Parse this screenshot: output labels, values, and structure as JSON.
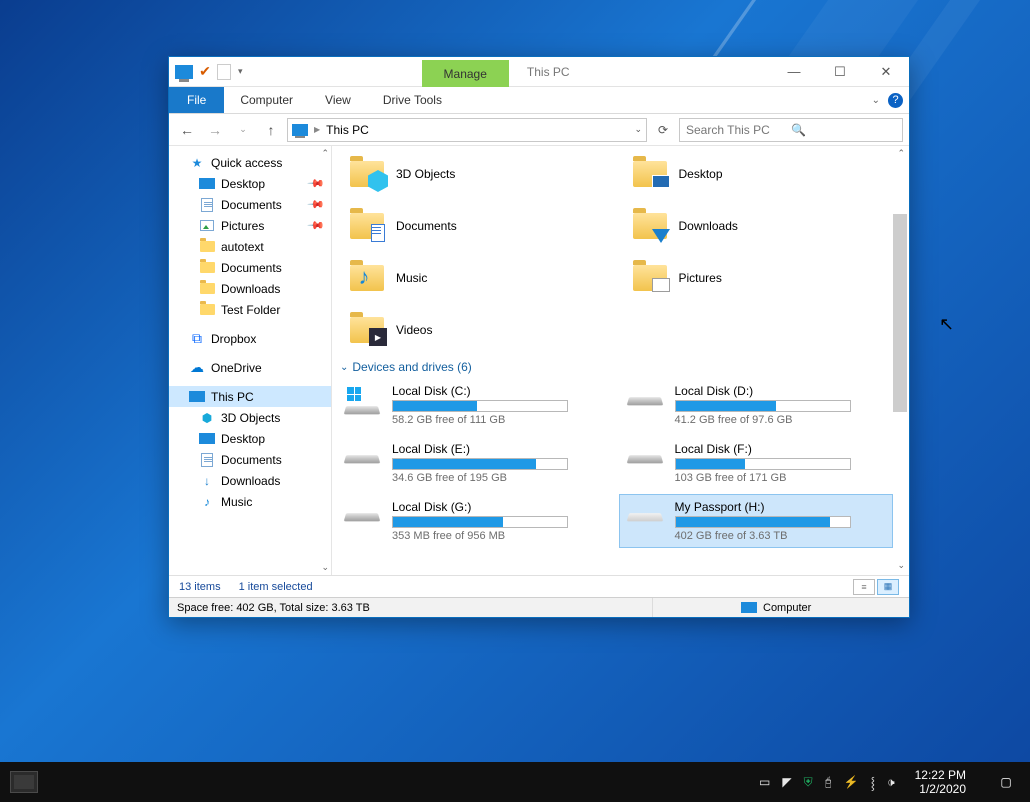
{
  "window": {
    "title": "This PC",
    "contextual_tab": "Manage",
    "ribbon_tabs": {
      "file": "File",
      "computer": "Computer",
      "view": "View",
      "drive_tools": "Drive Tools"
    }
  },
  "address": {
    "location": "This PC"
  },
  "search": {
    "placeholder": "Search This PC"
  },
  "sidebar": {
    "quick_access": "Quick access",
    "qa": {
      "desktop": "Desktop",
      "documents": "Documents",
      "pictures": "Pictures",
      "autotext": "autotext",
      "documents2": "Documents",
      "downloads": "Downloads",
      "test_folder": "Test Folder"
    },
    "dropbox": "Dropbox",
    "onedrive": "OneDrive",
    "this_pc": "This PC",
    "pc": {
      "objects3d": "3D Objects",
      "desktop": "Desktop",
      "documents": "Documents",
      "downloads": "Downloads",
      "music": "Music"
    }
  },
  "folders": {
    "objects3d": "3D Objects",
    "desktop": "Desktop",
    "documents": "Documents",
    "downloads": "Downloads",
    "music": "Music",
    "pictures": "Pictures",
    "videos": "Videos"
  },
  "section_devices": "Devices and drives (6)",
  "drives": {
    "c": {
      "title": "Local Disk (C:)",
      "sub": "58.2 GB free of 111 GB",
      "fill": 48
    },
    "d": {
      "title": "Local Disk (D:)",
      "sub": "41.2 GB free of 97.6 GB",
      "fill": 58
    },
    "e": {
      "title": "Local Disk (E:)",
      "sub": "34.6 GB free of 195 GB",
      "fill": 82
    },
    "f": {
      "title": "Local Disk (F:)",
      "sub": "103 GB free of 171 GB",
      "fill": 40
    },
    "g": {
      "title": "Local Disk (G:)",
      "sub": "353 MB free of 956 MB",
      "fill": 63
    },
    "h": {
      "title": "My Passport (H:)",
      "sub": "402 GB free of 3.63 TB",
      "fill": 89
    }
  },
  "status": {
    "items": "13 items",
    "selected": "1 item selected"
  },
  "footer": {
    "left": "Space free: 402 GB, Total size: 3.63 TB",
    "right": "Computer"
  },
  "taskbar": {
    "time": "12:22 PM",
    "date": "1/2/2020"
  }
}
